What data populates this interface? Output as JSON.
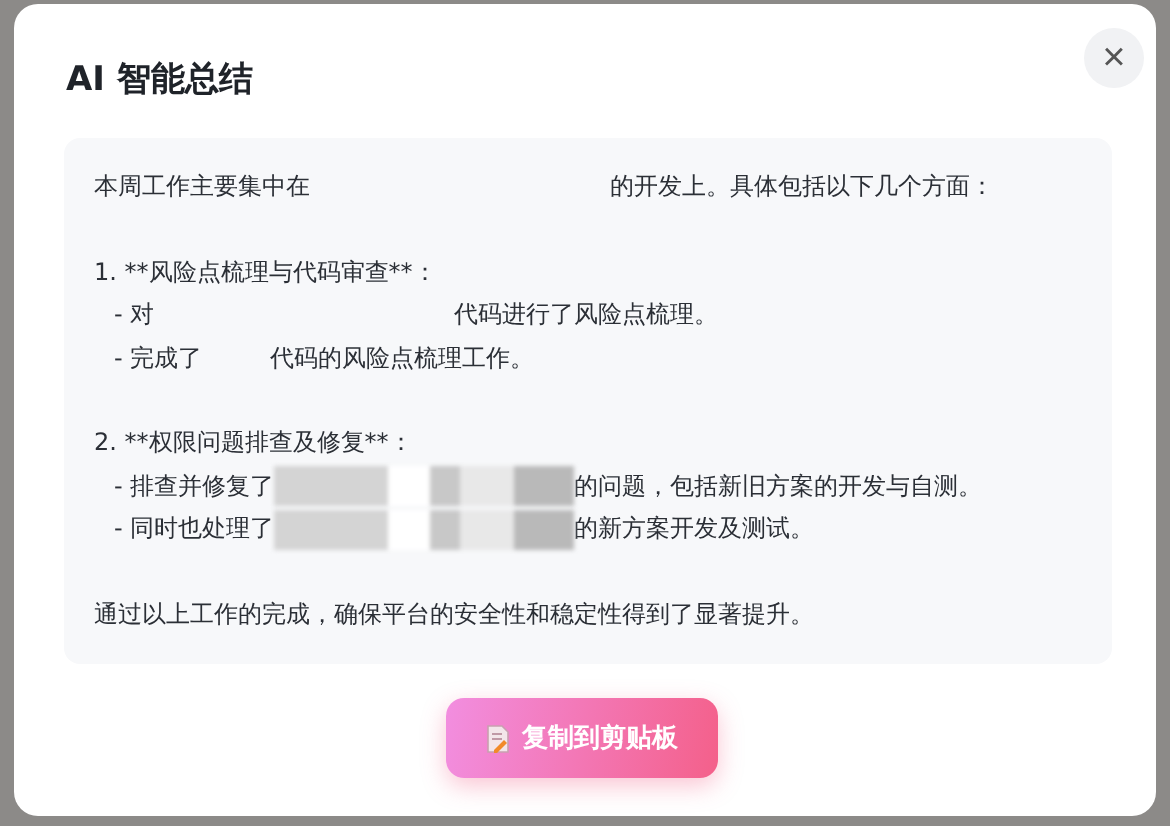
{
  "dialog": {
    "title": "AI 智能总结",
    "close": "×"
  },
  "summary": {
    "blocks": [
      {
        "lines": [
          {
            "kind": "plain",
            "segments": [
              {
                "kind": "text",
                "text": "本周工作主要集中在"
              },
              {
                "kind": "gap_long"
              },
              {
                "kind": "text",
                "text": "的开发上。具体包括以下几个方面："
              }
            ]
          }
        ]
      },
      {
        "lines": [
          {
            "kind": "plain",
            "segments": [
              {
                "kind": "text",
                "text": "1. **风险点梳理与代码审查**："
              }
            ]
          },
          {
            "kind": "item",
            "segments": [
              {
                "kind": "text",
                "text": "- 对"
              },
              {
                "kind": "gap_long"
              },
              {
                "kind": "text",
                "text": "代码进行了风险点梳理。"
              }
            ]
          },
          {
            "kind": "item",
            "segments": [
              {
                "kind": "text",
                "text": "- 完成了"
              },
              {
                "kind": "gap_short"
              },
              {
                "kind": "text",
                "text": "代码的风险点梳理工作。"
              }
            ]
          }
        ]
      },
      {
        "lines": [
          {
            "kind": "plain",
            "segments": [
              {
                "kind": "text",
                "text": "2. **权限问题排查及修复**："
              }
            ]
          },
          {
            "kind": "item",
            "segments": [
              {
                "kind": "text",
                "text": "- 排查并修复了"
              },
              {
                "kind": "blurred"
              },
              {
                "kind": "text",
                "text": "的问题，包括新旧方案的开发与自测。"
              }
            ]
          },
          {
            "kind": "item",
            "segments": [
              {
                "kind": "text",
                "text": "- 同时也处理了"
              },
              {
                "kind": "blurred"
              },
              {
                "kind": "text",
                "text": "的新方案开发及测试。"
              }
            ]
          }
        ]
      },
      {
        "lines": [
          {
            "kind": "plain",
            "segments": [
              {
                "kind": "text",
                "text": "通过以上工作的完成，确保平台的安全性和稳定性得到了显著提升。"
              }
            ]
          }
        ]
      }
    ]
  },
  "copy_button": {
    "label": "复制到剪贴板"
  }
}
